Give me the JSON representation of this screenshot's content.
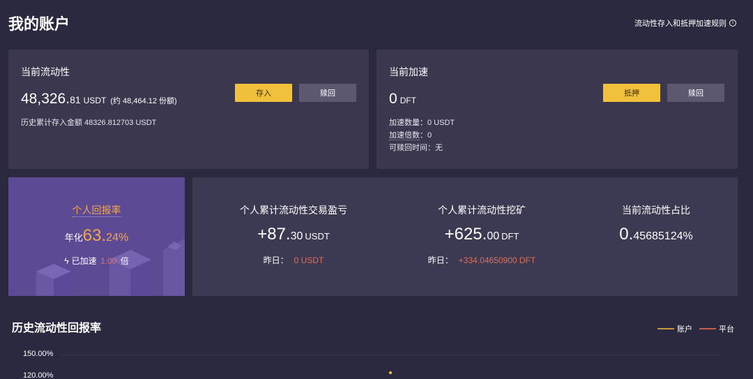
{
  "header": {
    "title": "我的账户",
    "rules_link": "流动性存入和抵押加速规则"
  },
  "liquidity": {
    "label": "当前流动性",
    "amount_int": "48,326.",
    "amount_dec": "81",
    "unit": "USDT",
    "approx": "(约 48,464.12 份额)",
    "history": "历史累计存入金额 48326.812703 USDT",
    "deposit_button": "存入",
    "redeem_button": "赎回"
  },
  "acceleration": {
    "label": "当前加速",
    "amount_int": "0",
    "unit": "DFT",
    "count_line": "加速数量：0 USDT",
    "multiple_label": "加速倍数",
    "multiple_value": "：0",
    "redeem_time_line": "可赎回时间：无",
    "pledge_button": "抵押",
    "redeem_button": "赎回"
  },
  "personal_yield": {
    "title": "个人回报率",
    "prefix": "年化",
    "int": "63.",
    "dec": "24%",
    "boosted_label": "已加速",
    "boost_value": "1.00",
    "boost_unit": "倍"
  },
  "stats": [
    {
      "title": "个人累计流动性交易盈亏",
      "value_int": "+87.",
      "value_dec": "30",
      "unit": "USDT",
      "yday_label": "昨日：",
      "yday_value": "0 USDT"
    },
    {
      "title": "个人累计流动性挖矿",
      "value_int": "+625.",
      "value_dec": "00",
      "unit": "DFT",
      "yday_label": "昨日：",
      "yday_value": "+334.04650900 DFT"
    },
    {
      "title": "当前流动性占比",
      "value_int": "0.",
      "value_dec": "45685124%"
    }
  ],
  "history_chart": {
    "title": "历史流动性回报率",
    "legend": [
      {
        "name": "账户",
        "color": "#c9963c"
      },
      {
        "name": "平台",
        "color": "#c0604a"
      }
    ],
    "y_ticks": [
      "150.00%",
      "120.00%"
    ]
  },
  "colors": {
    "accent_yellow": "#f1c13c",
    "accent_orange": "#f2a74a",
    "negative_red": "#e07058",
    "card_bg": "#3a374f",
    "page_bg": "#2b2940",
    "yield_card_bg": "#5d4a94"
  }
}
